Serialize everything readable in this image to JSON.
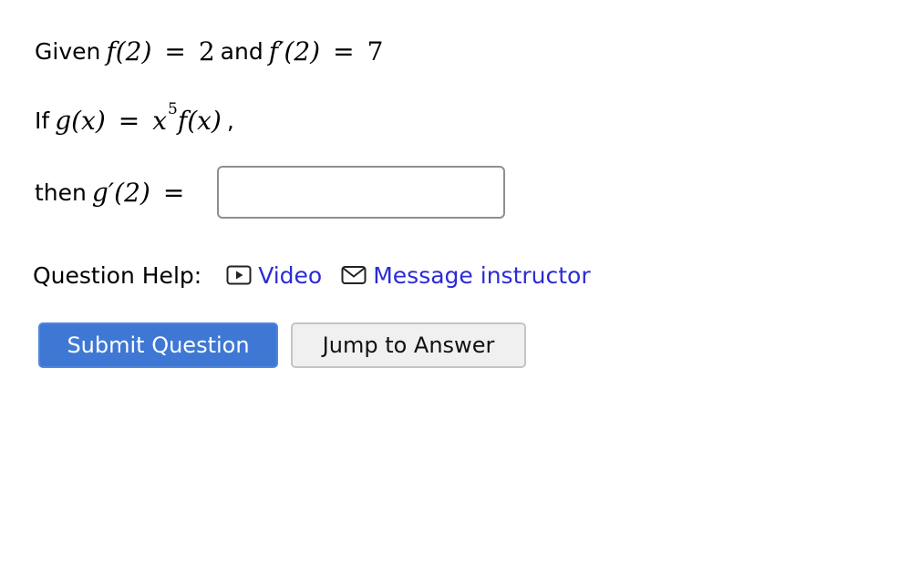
{
  "question": {
    "line1": {
      "prefix": "Given",
      "expr1_lhs": "f(2)",
      "expr1_rhs": "2",
      "conjunction": "and",
      "expr2_lhs": "f′(2)",
      "expr2_rhs": "7"
    },
    "line2": {
      "prefix": "If",
      "lhs": "g(x)",
      "rhs_base": "x",
      "rhs_exponent": "5",
      "rhs_factor": "f(x)",
      "trailing": ","
    },
    "line3": {
      "prefix": "then",
      "lhs": "g′(2)",
      "input_value": ""
    }
  },
  "help": {
    "label": "Question Help:",
    "video_label": "Video",
    "video_icon": "video-play-icon",
    "message_label": "Message instructor",
    "message_icon": "envelope-icon"
  },
  "buttons": {
    "submit_label": "Submit Question",
    "jump_label": "Jump to Answer"
  },
  "colors": {
    "link": "#2b2bd6",
    "primary_button": "#3f78d4",
    "secondary_button": "#f0f0f0"
  }
}
